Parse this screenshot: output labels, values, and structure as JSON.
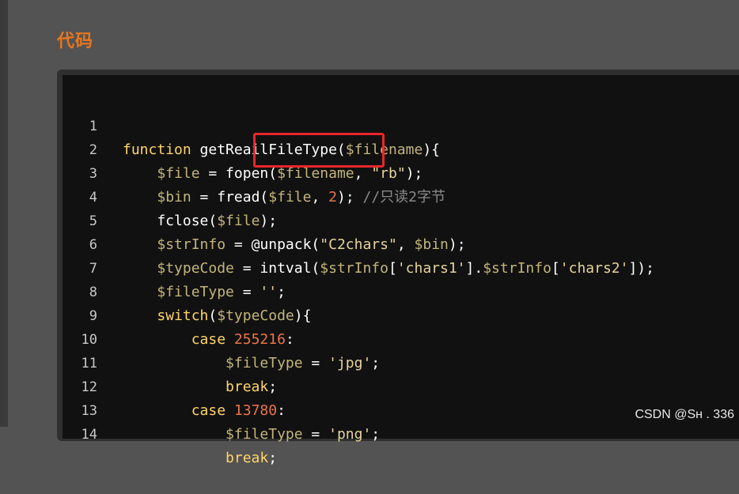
{
  "section": {
    "title": "代码"
  },
  "code": {
    "lines": [
      {
        "num": "1",
        "text": "function getReailFileType($filename){"
      },
      {
        "num": "2",
        "text": "    $file = fopen($filename, \"rb\");"
      },
      {
        "num": "3",
        "text": "    $bin = fread($file, 2); //只读2字节"
      },
      {
        "num": "4",
        "text": "    fclose($file);"
      },
      {
        "num": "5",
        "text": "    $strInfo = @unpack(\"C2chars\", $bin);"
      },
      {
        "num": "6",
        "text": "    $typeCode = intval($strInfo['chars1'].$strInfo['chars2']);"
      },
      {
        "num": "7",
        "text": "    $fileType = '';"
      },
      {
        "num": "8",
        "text": "    switch($typeCode){"
      },
      {
        "num": "9",
        "text": "        case 255216:"
      },
      {
        "num": "10",
        "text": "            $fileType = 'jpg';"
      },
      {
        "num": "11",
        "text": "            break;"
      },
      {
        "num": "12",
        "text": "        case 13780:"
      },
      {
        "num": "13",
        "text": "            $fileType = 'png';"
      },
      {
        "num": "14",
        "text": "            break;"
      }
    ]
  },
  "watermark": {
    "text": "CSDN @Sн    . 336"
  },
  "colors": {
    "accent": "#e8761f",
    "highlight": "#e8262b",
    "code_bg": "#111111"
  }
}
